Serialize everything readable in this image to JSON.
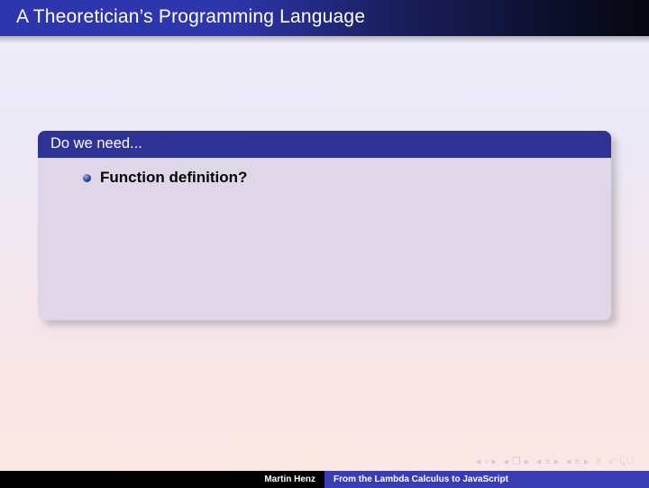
{
  "title": "A Theoretician’s Programming Language",
  "block": {
    "header": "Do we need...",
    "items": [
      "Function definition?"
    ]
  },
  "nav": {
    "first": "◂ ▫ ▸",
    "prev": "◂ ❐ ▸",
    "up": "◂ ≡ ▸",
    "next": "◂ ≡ ▸",
    "toc": "≡",
    "back": "⤺⤹↺"
  },
  "footer": {
    "author": "Martin Henz",
    "talk": "From the Lambda Calculus to JavaScript"
  }
}
